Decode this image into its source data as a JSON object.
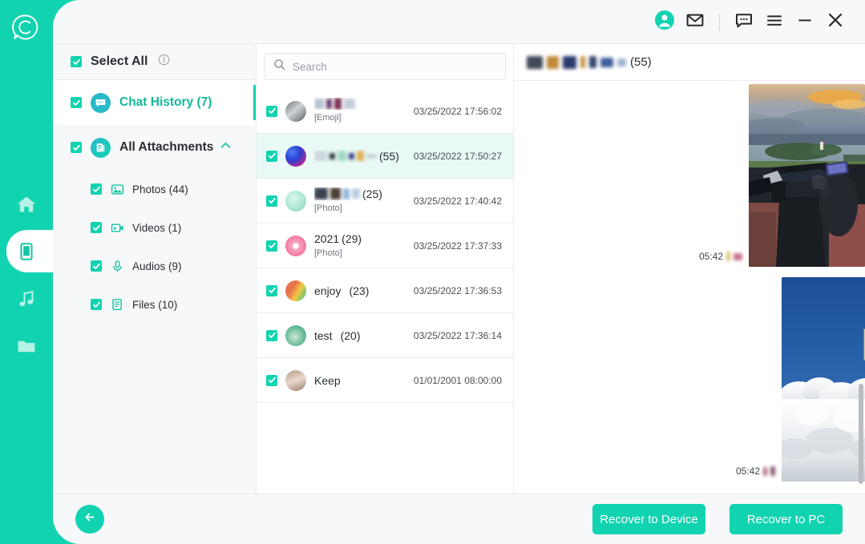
{
  "app": {
    "logo_icon": "chat-c-logo"
  },
  "titlebar": {
    "account_icon": "user-avatar-icon",
    "mail_icon": "envelope-icon",
    "feedback_icon": "chat-bubble-icon",
    "menu_icon": "hamburger-menu-icon",
    "minimize_icon": "minimize-icon",
    "close_icon": "close-icon"
  },
  "rail": {
    "items": [
      {
        "icon": "home-icon",
        "name": "home",
        "active": false
      },
      {
        "icon": "phone-icon",
        "name": "device",
        "active": true
      },
      {
        "icon": "music-note-icon",
        "name": "music",
        "active": false
      },
      {
        "icon": "folder-icon",
        "name": "files",
        "active": false
      }
    ]
  },
  "tree": {
    "select_all_label": "Select All",
    "select_all_checked": true,
    "info_icon": "info-circle-icon",
    "nodes": [
      {
        "label": "Chat History (7)",
        "icon": "chat-history-icon",
        "checked": true,
        "selected": true
      },
      {
        "label": "All Attachments",
        "icon": "attachments-icon",
        "checked": true,
        "selected": false,
        "expanded": true,
        "chevron_icon": "chevron-up-icon"
      }
    ],
    "children": [
      {
        "label": "Photos (44)",
        "icon": "photo-icon",
        "checked": true
      },
      {
        "label": "Videos (1)",
        "icon": "video-icon",
        "checked": true
      },
      {
        "label": "Audios (9)",
        "icon": "microphone-icon",
        "checked": true
      },
      {
        "label": "Files (10)",
        "icon": "file-icon",
        "checked": true
      }
    ]
  },
  "search": {
    "placeholder": "Search",
    "value": "",
    "icon": "search-icon"
  },
  "chat_list": [
    {
      "name": "",
      "name_redacted": true,
      "count": "",
      "preview": "[Emoji]",
      "time": "03/25/2022 17:56:02",
      "checked": true,
      "selected": false,
      "avatar_color": "#8e9196"
    },
    {
      "name": "",
      "name_redacted": true,
      "count": "(55)",
      "preview": "",
      "time": "03/25/2022 17:50:27",
      "checked": true,
      "selected": true,
      "avatar_color": "#3b5bdb"
    },
    {
      "name": "",
      "name_redacted": true,
      "count": "(25)",
      "preview": "[Photo]",
      "time": "03/25/2022 17:40:42",
      "checked": true,
      "selected": false,
      "avatar_color": "#a8e6cf"
    },
    {
      "name": "2021",
      "name_redacted": false,
      "count": "(29)",
      "preview": "[Photo]",
      "time": "03/25/2022 17:37:33",
      "checked": true,
      "selected": false,
      "avatar_color": "#f8c8d4"
    },
    {
      "name": "enjoy",
      "name_redacted": false,
      "count": "(23)",
      "preview": "",
      "time": "03/25/2022 17:36:53",
      "checked": true,
      "selected": false,
      "avatar_color": "#e8734a"
    },
    {
      "name": "test",
      "name_redacted": false,
      "count": "(20)",
      "preview": "",
      "time": "03/25/2022 17:36:14",
      "checked": true,
      "selected": false,
      "avatar_color": "#6bbf9a"
    },
    {
      "name": "Keep",
      "name_redacted": false,
      "count": "",
      "preview": "",
      "time": "01/01/2001 08:00:00",
      "checked": true,
      "selected": false,
      "avatar_color": "#9c7b6b"
    }
  ],
  "preview": {
    "title_redacted": true,
    "title": "",
    "count": "(55)",
    "messages": [
      {
        "time": "05:42",
        "type": "photo",
        "description": "sunset-lake-convertible-photo"
      },
      {
        "time": "05:42",
        "type": "photo",
        "description": "blue-sky-clouds-photo"
      }
    ]
  },
  "footer": {
    "back_icon": "arrow-left-icon",
    "recover_device_label": "Recover to Device",
    "recover_pc_label": "Recover to PC"
  },
  "colors": {
    "accent": "#12D3B0",
    "accent_text": "#12B89A",
    "selected_row": "#e9f9f5",
    "panel_bg": "#f7f8f9"
  }
}
